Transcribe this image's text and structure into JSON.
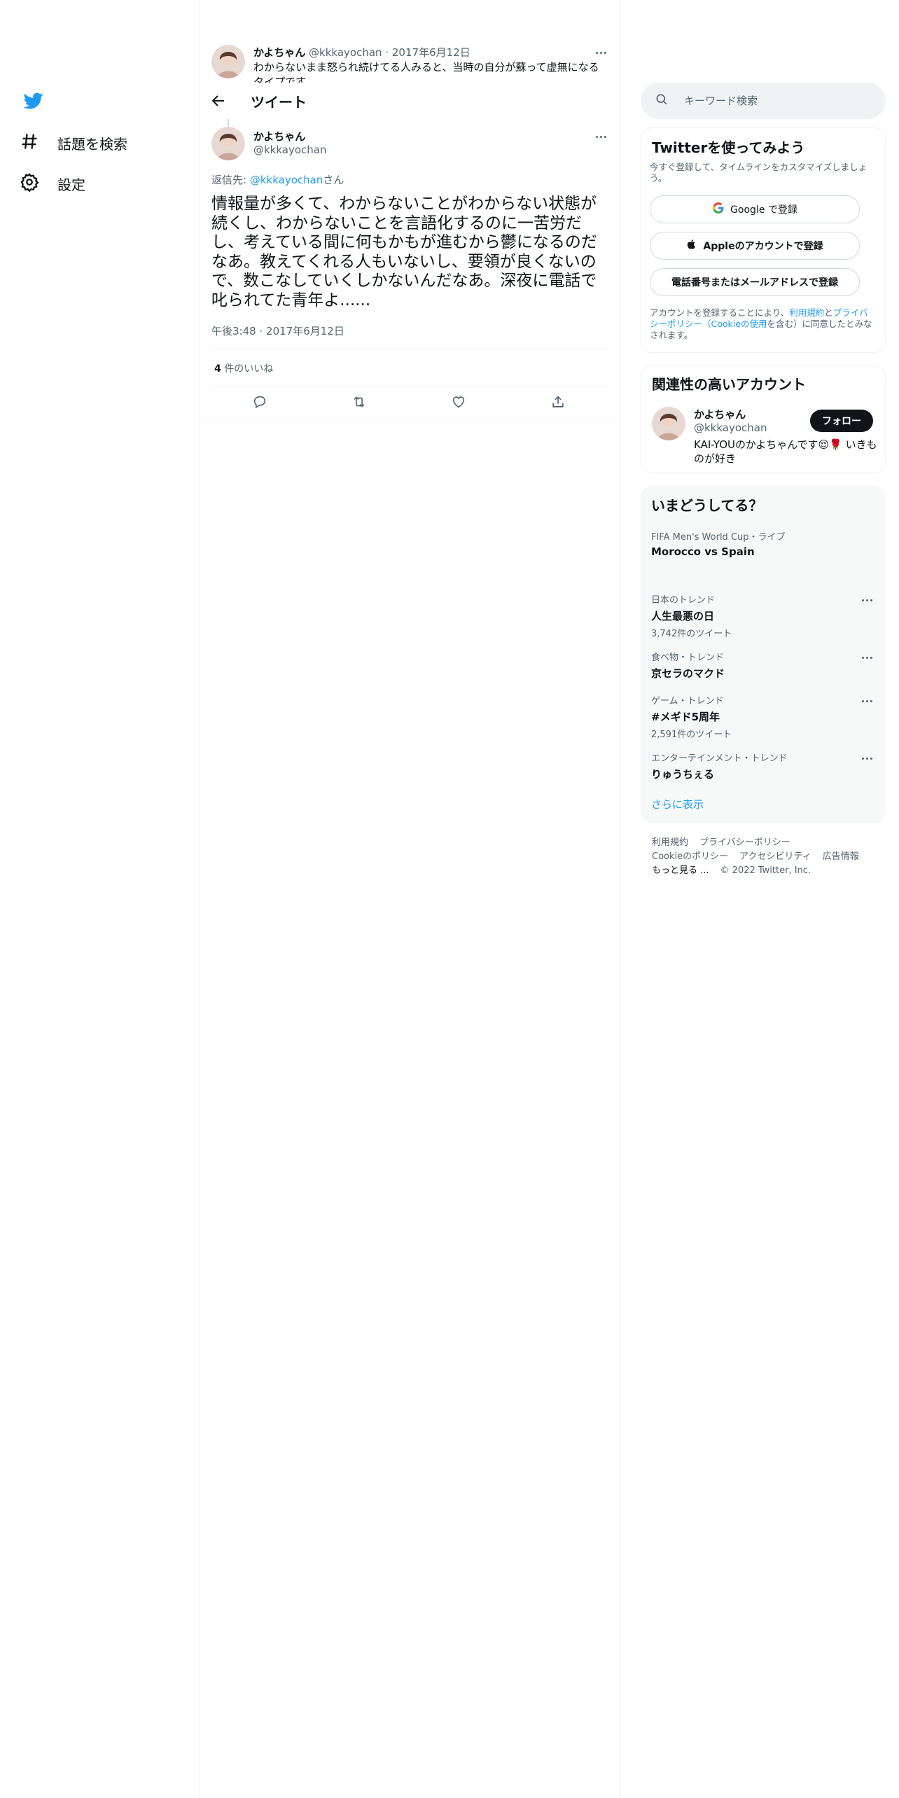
{
  "nav": {
    "items": [
      {
        "label": "話題を検索",
        "icon": "hashtag-icon"
      },
      {
        "label": "設定",
        "icon": "gear-icon"
      }
    ]
  },
  "parent_tweet": {
    "name": "かよちゃん",
    "handle": "@kkkayochan",
    "separator": "·",
    "date": "2017年6月12日",
    "text": "わからないまま怒られ続けてる人みると、当時の自分が蘇って虚無になるタイプです"
  },
  "header": {
    "title": "ツイート"
  },
  "tweet": {
    "name": "かよちゃん",
    "handle": "@kkkayochan",
    "reply_prefix": "返信先: ",
    "reply_handle": "@kkkayochan",
    "reply_suffix": "さん",
    "body": "情報量が多くて、わからないことがわからない状態が続くし、わからないことを言語化するのに一苦労だし、考えている間に何もかもが進むから鬱になるのだなあ。教えてくれる人もいないし、要領が良くないので、数こなしていくしかないんだなあ。深夜に電話で叱られてた青年よ......",
    "time": "午後3:48",
    "meta_sep": "·",
    "date": "2017年6月12日",
    "likes_count": "4",
    "likes_label": "件のいいね"
  },
  "search": {
    "placeholder": "キーワード検索"
  },
  "signup": {
    "title": "Twitterを使ってみよう",
    "subtitle": "今すぐ登録して、タイムラインをカスタマイズしましょう。",
    "google_label": "Google で登録",
    "apple_label": "Appleのアカウントで登録",
    "phone_label": "電話番号またはメールアドレスで登録",
    "legal_prefix": "アカウントを登録することにより、",
    "legal_terms": "利用規約",
    "legal_and": "と",
    "legal_privacy": "プライバシーポリシー（Cookieの使用",
    "legal_suffix": "を含む）に同意したとみなされます。"
  },
  "related": {
    "title": "関連性の高いアカウント",
    "name": "かよちゃん",
    "handle": "@kkkayochan",
    "follow_label": "フォロー",
    "bio": "KAI-YOUのかよちゃんです😌🌹 いきものが好き"
  },
  "trends": {
    "title": "いまどうしてる？",
    "items": [
      {
        "context": "FIFA Men's World Cup・ライブ",
        "name": "Morocco vs Spain",
        "count": ""
      },
      {
        "context": "日本のトレンド",
        "name": "人生最悪の日",
        "count": "3,742件のツイート"
      },
      {
        "context": "食べ物・トレンド",
        "name": "京セラのマクド",
        "count": ""
      },
      {
        "context": "ゲーム・トレンド",
        "name": "#メギド5周年",
        "count": "2,591件のツイート"
      },
      {
        "context": "エンターテインメント・トレンド",
        "name": "りゅうちぇる",
        "count": ""
      }
    ],
    "show_more": "さらに表示"
  },
  "footer": {
    "line1": [
      "利用規約",
      "プライバシーポリシー"
    ],
    "line2": [
      "Cookieのポリシー",
      "アクセシビリティ",
      "広告情報"
    ],
    "more": "もっと見る ...",
    "copyright": "© 2022 Twitter, Inc."
  },
  "colors": {
    "accent": "#1d9bf0",
    "text": "#0f1419",
    "muted": "#536471",
    "border": "#eff3f4"
  }
}
